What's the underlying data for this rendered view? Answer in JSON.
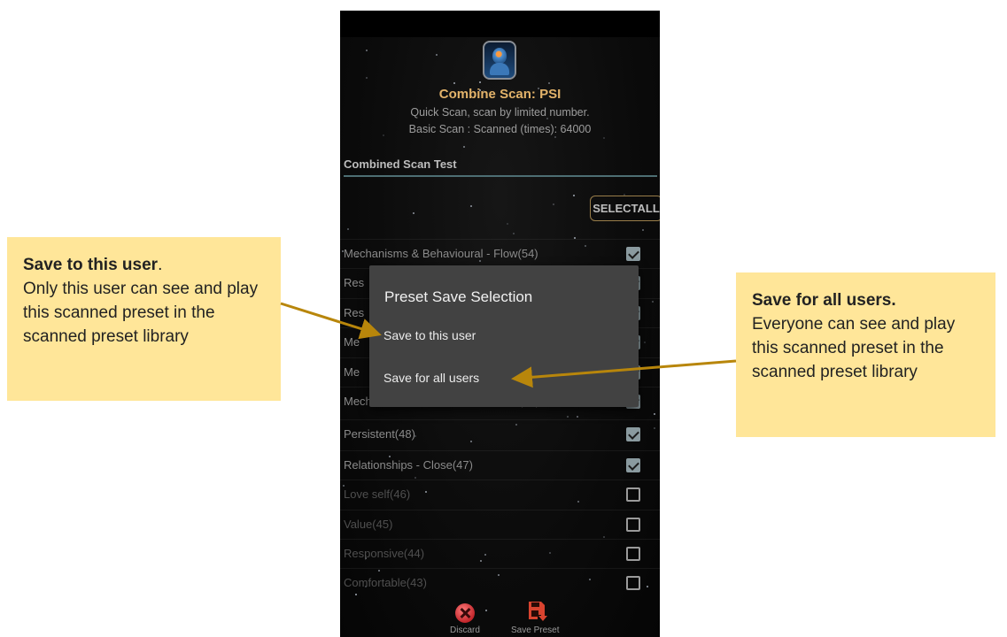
{
  "screen": {
    "title": "Combine Scan: PSI",
    "subtitle_line1": "Quick Scan, scan by limited number.",
    "subtitle_line2": "Basic Scan : Scanned (times): 64000",
    "section_label": "Combined Scan Test",
    "select_all_label": "SELECTALL"
  },
  "list": {
    "items": [
      {
        "label": "Mechanisms & Behavioural - Flow(54)",
        "checked": true
      },
      {
        "label": "Res",
        "checked": true
      },
      {
        "label": "Res",
        "checked": true
      },
      {
        "label": "Me",
        "checked": true
      },
      {
        "label": "Me",
        "checked": true
      },
      {
        "label": "Mechanisms & Behavioural - Wise(49)",
        "checked": true
      },
      {
        "label": "Persistent(48)",
        "checked": true
      },
      {
        "label": "Relationships - Close(47)",
        "checked": true
      },
      {
        "label": "Love self(46)",
        "checked": false
      },
      {
        "label": "Value(45)",
        "checked": false
      },
      {
        "label": "Responsive(44)",
        "checked": false
      },
      {
        "label": "Comfortable(43)",
        "checked": false
      }
    ]
  },
  "dialog": {
    "title": "Preset Save Selection",
    "option_this_user": "Save to this user",
    "option_all_users": "Save for all users"
  },
  "bottom_bar": {
    "discard_label": "Discard",
    "save_preset_label": "Save Preset"
  },
  "callouts": {
    "left_heading": "Save to this user",
    "left_heading_suffix": ".",
    "left_body": "Only this user can see and play this scanned preset in the scanned preset library",
    "right_heading": "Save for all users.",
    "right_body": "Everyone can see and play this scanned preset in the scanned preset library"
  },
  "colors": {
    "callout_bg": "#ffe699",
    "arrow": "#b8860b",
    "title_accent": "#e3b36a",
    "dialog_bg": "#424242"
  }
}
